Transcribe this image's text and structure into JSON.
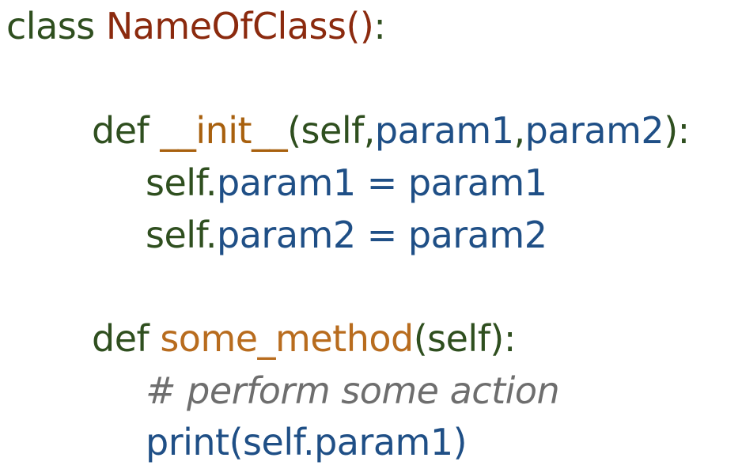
{
  "code_lines": {
    "line1": {
      "kw": "class",
      "space": " ",
      "class_name": "NameOfClass",
      "paren": "()",
      "colon": ":"
    },
    "line2": {
      "kw": "def",
      "space": " ",
      "method_name": "__init__",
      "open": "(",
      "self": "self",
      "comma1": ",",
      "param1": "param1",
      "comma2": ",",
      "param2": "param2",
      "close": ")",
      "colon": ":"
    },
    "line3": {
      "self_attr": "self.",
      "attr": "param1",
      "op": " = ",
      "value": "param1"
    },
    "line4": {
      "self_attr": "self.",
      "attr": "param2",
      "op": " = ",
      "value": "param2"
    },
    "line5": {
      "kw": "def",
      "space": " ",
      "method_name": "some_method",
      "open": "(",
      "self": "self",
      "close": ")",
      "colon": ":"
    },
    "line6": {
      "comment": "# perform some action"
    },
    "line7": {
      "func": "print",
      "open": "(",
      "arg": "self.param1",
      "close": ")"
    }
  },
  "colors": {
    "keyword": "#2f4f1f",
    "class_name": "#8b2a0e",
    "dunder_method": "#a8600e",
    "method_name": "#b86c1e",
    "parameter": "#1f4f86",
    "comment": "#6e6e6e",
    "background": "#ffffff"
  }
}
